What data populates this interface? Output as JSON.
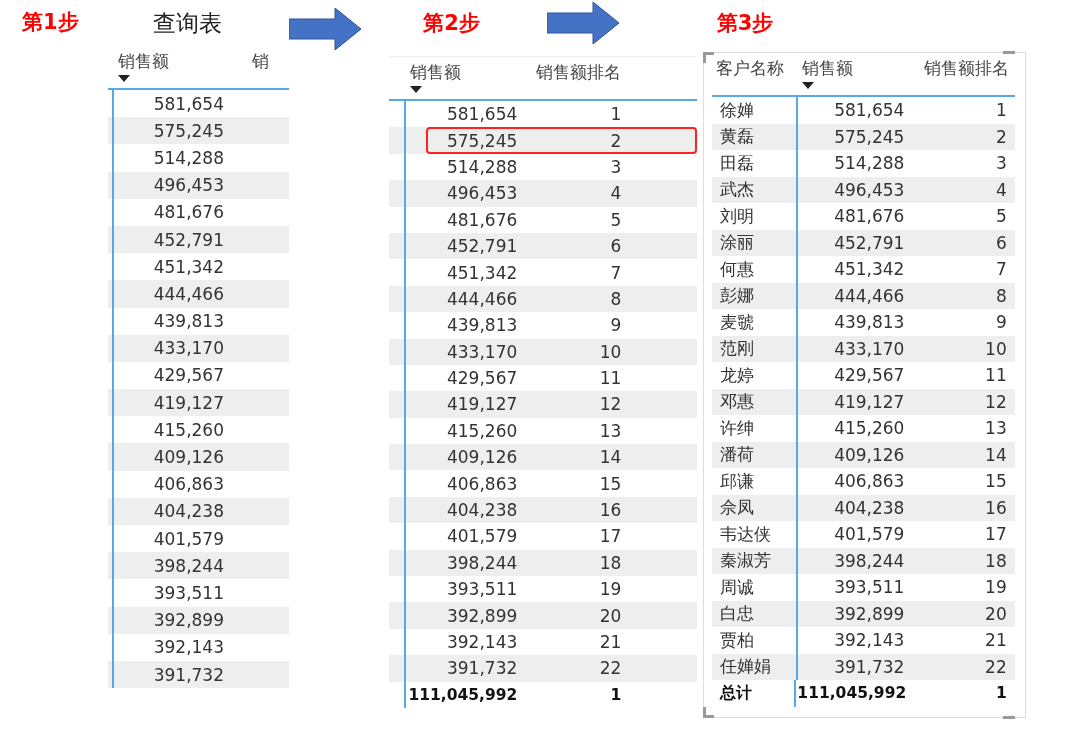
{
  "panels": [
    {
      "step": "第1步",
      "title": "查询表",
      "table": {
        "columns": [
          {
            "label": "销售额",
            "sorted": true
          },
          {
            "label": "销",
            "sorted": false
          }
        ],
        "rows": [
          {
            "cells": [
              "581,654"
            ]
          },
          {
            "cells": [
              "575,245"
            ]
          },
          {
            "cells": [
              "514,288"
            ]
          },
          {
            "cells": [
              "496,453"
            ]
          },
          {
            "cells": [
              "481,676"
            ]
          },
          {
            "cells": [
              "452,791"
            ]
          },
          {
            "cells": [
              "451,342"
            ]
          },
          {
            "cells": [
              "444,466"
            ]
          },
          {
            "cells": [
              "439,813"
            ]
          },
          {
            "cells": [
              "433,170"
            ]
          },
          {
            "cells": [
              "429,567"
            ]
          },
          {
            "cells": [
              "419,127"
            ]
          },
          {
            "cells": [
              "415,260"
            ]
          },
          {
            "cells": [
              "409,126"
            ]
          },
          {
            "cells": [
              "406,863"
            ]
          },
          {
            "cells": [
              "404,238"
            ]
          },
          {
            "cells": [
              "401,579"
            ]
          },
          {
            "cells": [
              "398,244"
            ]
          },
          {
            "cells": [
              "393,511"
            ]
          },
          {
            "cells": [
              "392,899"
            ]
          },
          {
            "cells": [
              "392,143"
            ]
          },
          {
            "cells": [
              "391,732"
            ]
          }
        ]
      }
    },
    {
      "step": "第2步",
      "table": {
        "columns": [
          {
            "label": "销售额",
            "sorted": true
          },
          {
            "label": "销售额排名",
            "sorted": false
          }
        ],
        "rows": [
          {
            "cells": [
              "581,654",
              "1"
            ],
            "highlighted": false
          },
          {
            "cells": [
              "575,245",
              "2"
            ],
            "highlighted": true
          },
          {
            "cells": [
              "514,288",
              "3"
            ],
            "highlighted": false
          },
          {
            "cells": [
              "496,453",
              "4"
            ],
            "highlighted": false
          },
          {
            "cells": [
              "481,676",
              "5"
            ],
            "highlighted": false
          },
          {
            "cells": [
              "452,791",
              "6"
            ],
            "highlighted": false
          },
          {
            "cells": [
              "451,342",
              "7"
            ],
            "highlighted": false
          },
          {
            "cells": [
              "444,466",
              "8"
            ],
            "highlighted": false
          },
          {
            "cells": [
              "439,813",
              "9"
            ],
            "highlighted": false
          },
          {
            "cells": [
              "433,170",
              "10"
            ],
            "highlighted": false
          },
          {
            "cells": [
              "429,567",
              "11"
            ],
            "highlighted": false
          },
          {
            "cells": [
              "419,127",
              "12"
            ],
            "highlighted": false
          },
          {
            "cells": [
              "415,260",
              "13"
            ],
            "highlighted": false
          },
          {
            "cells": [
              "409,126",
              "14"
            ],
            "highlighted": false
          },
          {
            "cells": [
              "406,863",
              "15"
            ],
            "highlighted": false
          },
          {
            "cells": [
              "404,238",
              "16"
            ],
            "highlighted": false
          },
          {
            "cells": [
              "401,579",
              "17"
            ],
            "highlighted": false
          },
          {
            "cells": [
              "398,244",
              "18"
            ],
            "highlighted": false
          },
          {
            "cells": [
              "393,511",
              "19"
            ],
            "highlighted": false
          },
          {
            "cells": [
              "392,899",
              "20"
            ],
            "highlighted": false
          },
          {
            "cells": [
              "392,143",
              "21"
            ],
            "highlighted": false
          },
          {
            "cells": [
              "391,732",
              "22"
            ],
            "highlighted": false
          }
        ],
        "total": [
          "111,045,992",
          "1"
        ]
      }
    },
    {
      "step": "第3步",
      "table": {
        "columns": [
          {
            "label": "客户名称",
            "sorted": false
          },
          {
            "label": "销售额",
            "sorted": true
          },
          {
            "label": "销售额排名",
            "sorted": false
          }
        ],
        "rows": [
          {
            "cells": [
              "徐婵",
              "581,654",
              "1"
            ]
          },
          {
            "cells": [
              "黄磊",
              "575,245",
              "2"
            ]
          },
          {
            "cells": [
              "田磊",
              "514,288",
              "3"
            ]
          },
          {
            "cells": [
              "武杰",
              "496,453",
              "4"
            ]
          },
          {
            "cells": [
              "刘明",
              "481,676",
              "5"
            ]
          },
          {
            "cells": [
              "涂丽",
              "452,791",
              "6"
            ]
          },
          {
            "cells": [
              "何惠",
              "451,342",
              "7"
            ]
          },
          {
            "cells": [
              "彭娜",
              "444,466",
              "8"
            ]
          },
          {
            "cells": [
              "麦虢",
              "439,813",
              "9"
            ]
          },
          {
            "cells": [
              "范刚",
              "433,170",
              "10"
            ]
          },
          {
            "cells": [
              "龙婷",
              "429,567",
              "11"
            ]
          },
          {
            "cells": [
              "邓惠",
              "419,127",
              "12"
            ]
          },
          {
            "cells": [
              "许绅",
              "415,260",
              "13"
            ]
          },
          {
            "cells": [
              "潘荷",
              "409,126",
              "14"
            ]
          },
          {
            "cells": [
              "邱谦",
              "406,863",
              "15"
            ]
          },
          {
            "cells": [
              "佘凤",
              "404,238",
              "16"
            ]
          },
          {
            "cells": [
              "韦达侠",
              "401,579",
              "17"
            ]
          },
          {
            "cells": [
              "秦淑芳",
              "398,244",
              "18"
            ]
          },
          {
            "cells": [
              "周诚",
              "393,511",
              "19"
            ]
          },
          {
            "cells": [
              "白忠",
              "392,899",
              "20"
            ]
          },
          {
            "cells": [
              "贾柏",
              "392,143",
              "21"
            ]
          },
          {
            "cells": [
              "任婵娟",
              "391,732",
              "22"
            ]
          }
        ],
        "total": [
          "总计",
          "111,045,992",
          "1"
        ]
      }
    }
  ]
}
